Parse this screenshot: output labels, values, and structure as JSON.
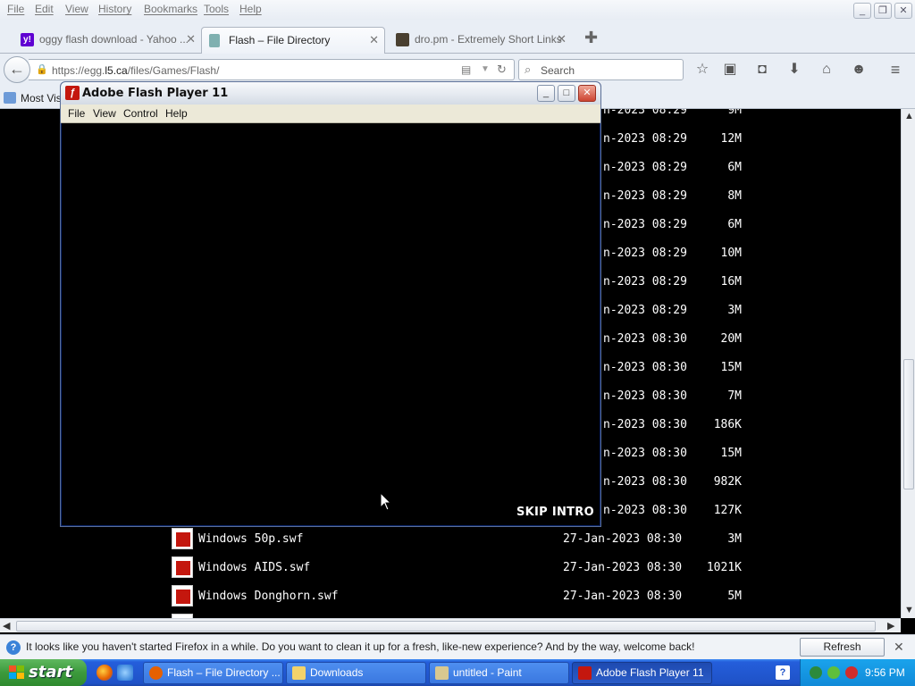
{
  "firefox": {
    "menu": [
      "File",
      "Edit",
      "View",
      "History",
      "Bookmarks",
      "Tools",
      "Help"
    ],
    "tabs": [
      {
        "title": "oggy flash download - Yahoo ...",
        "favicon_color": "#6001d2",
        "active": false
      },
      {
        "title": "Flash – File Directory",
        "favicon_color": "#6f9fa0",
        "active": true
      },
      {
        "title": "dro.pm - Extremely Short Links",
        "favicon_color": "#4a4030",
        "active": false
      }
    ],
    "url_prefix": "https://egg.",
    "url_domain": "l5.ca",
    "url_path": "/files/Games/Flash/",
    "search_placeholder": "Search",
    "bookmarks_label": "Most Visi"
  },
  "listing": {
    "rows": [
      {
        "name": "",
        "date": "n-2023 08:29",
        "size": "9M"
      },
      {
        "name": "",
        "date": "n-2023 08:29",
        "size": "12M"
      },
      {
        "name": "",
        "date": "n-2023 08:29",
        "size": "6M"
      },
      {
        "name": "",
        "date": "n-2023 08:29",
        "size": "8M"
      },
      {
        "name": "",
        "date": "n-2023 08:29",
        "size": "6M"
      },
      {
        "name": "",
        "date": "n-2023 08:29",
        "size": "10M"
      },
      {
        "name": "",
        "date": "n-2023 08:29",
        "size": "16M"
      },
      {
        "name": "",
        "date": "n-2023 08:29",
        "size": "3M"
      },
      {
        "name": "",
        "date": "n-2023 08:30",
        "size": "20M"
      },
      {
        "name": "",
        "date": "n-2023 08:30",
        "size": "15M"
      },
      {
        "name": "",
        "date": "n-2023 08:30",
        "size": "7M"
      },
      {
        "name": "",
        "date": "n-2023 08:30",
        "size": "186K"
      },
      {
        "name": "",
        "date": "n-2023 08:30",
        "size": "15M"
      },
      {
        "name": "",
        "date": "n-2023 08:30",
        "size": "982K"
      },
      {
        "name": "",
        "date": "n-2023 08:30",
        "size": "127K"
      },
      {
        "name": "Windows 50p.swf",
        "date": "27-Jan-2023 08:30",
        "size": "3M"
      },
      {
        "name": "Windows AIDS.swf",
        "date": "27-Jan-2023 08:30",
        "size": "1021K"
      },
      {
        "name": "Windows Donghorn.swf",
        "date": "27-Jan-2023 08:30",
        "size": "5M"
      }
    ]
  },
  "notification": {
    "text": "It looks like you haven't started Firefox in a while. Do you want to clean it up for a fresh, like-new experience? And by the way, welcome back!",
    "button": "Refresh Firefox…"
  },
  "flash_window": {
    "title": "Adobe Flash Player 11",
    "menu": [
      "File",
      "View",
      "Control",
      "Help"
    ],
    "skip_label": "SKIP INTRO"
  },
  "taskbar": {
    "start_label": "start",
    "tasks": [
      {
        "label": "Flash – File Directory ...",
        "icon_color": "#e66000",
        "active": false
      },
      {
        "label": "Downloads",
        "icon_color": "#f3d36b",
        "active": false
      },
      {
        "label": "untitled - Paint",
        "icon_color": "#d8c890",
        "active": false
      },
      {
        "label": "Adobe Flash Player 11",
        "icon_color": "#c4170e",
        "active": true
      }
    ],
    "clock": "9:56 PM"
  }
}
